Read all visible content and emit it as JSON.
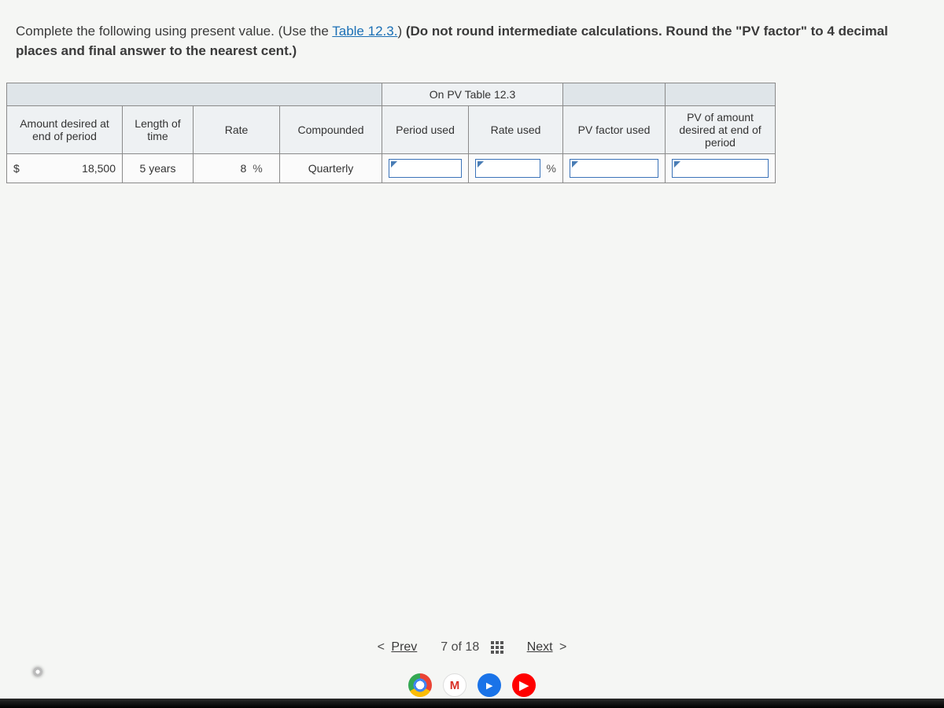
{
  "instructions": {
    "pre": "Complete the following using present value. (Use the ",
    "link": "Table 12.3.",
    "post1": ") ",
    "bold": "(Do not round intermediate calculations. Round the \"PV factor\" to 4 decimal places and final answer to the nearest cent.)"
  },
  "table": {
    "super_header": "On PV Table 12.3",
    "headers": {
      "amount": "Amount desired at end of period",
      "length": "Length of time",
      "rate": "Rate",
      "compounded": "Compounded",
      "period_used": "Period used",
      "rate_used": "Rate used",
      "pv_factor": "PV factor used",
      "pv_amount": "PV of amount desired at end of period"
    },
    "row": {
      "currency": "$",
      "amount": "18,500",
      "length": "5 years",
      "rate": "8",
      "rate_suffix": "%",
      "compounded": "Quarterly",
      "period_used": "",
      "rate_used": "",
      "rate_used_suffix": "%",
      "pv_factor": "",
      "pv_amount": ""
    }
  },
  "nav": {
    "prev": "Prev",
    "position": "7 of 18",
    "next": "Next"
  },
  "taskbar_icons": [
    "chrome",
    "gmail",
    "files",
    "youtube"
  ]
}
